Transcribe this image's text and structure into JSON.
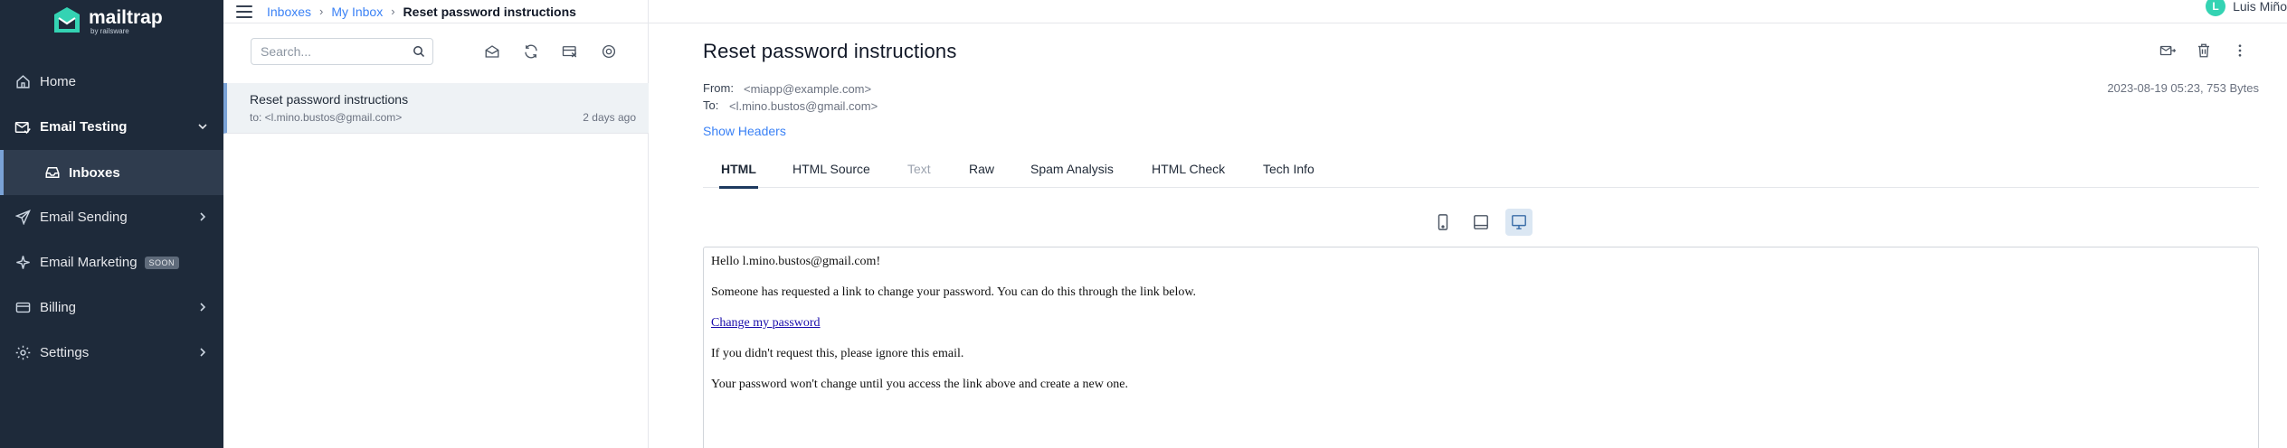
{
  "brand": {
    "name": "mailtrap",
    "sub": "by railsware"
  },
  "sidebar": {
    "items": [
      {
        "label": "Home",
        "icon": "home-icon"
      },
      {
        "label": "Email Testing",
        "icon": "email-testing-icon"
      },
      {
        "label": "Inboxes",
        "icon": "inbox-icon"
      },
      {
        "label": "Email Sending",
        "icon": "send-icon"
      },
      {
        "label": "Email Marketing",
        "icon": "sparkle-icon",
        "badge": "SOON"
      },
      {
        "label": "Billing",
        "icon": "billing-icon"
      },
      {
        "label": "Settings",
        "icon": "gear-icon"
      }
    ]
  },
  "breadcrumb": {
    "items": [
      "Inboxes",
      "My Inbox"
    ],
    "current": "Reset password instructions"
  },
  "user": {
    "initial": "L",
    "name": "Luis Miño"
  },
  "search": {
    "placeholder": "Search..."
  },
  "messages": [
    {
      "subject": "Reset password instructions",
      "to": "to: <l.mino.bustos@gmail.com>",
      "time": "2 days ago"
    }
  ],
  "email": {
    "subject": "Reset password instructions",
    "from_label": "From:",
    "from": "<miapp@example.com>",
    "to_label": "To:",
    "to": "<l.mino.bustos@gmail.com>",
    "show_headers": "Show Headers",
    "meta": "2023-08-19 05:23, 753 Bytes",
    "tabs": [
      "HTML",
      "HTML Source",
      "Text",
      "Raw",
      "Spam Analysis",
      "HTML Check",
      "Tech Info"
    ],
    "active_tab": "HTML",
    "body": {
      "greeting": "Hello l.mino.bustos@gmail.com!",
      "line1": "Someone has requested a link to change your password. You can do this through the link below.",
      "link": "Change my password",
      "line2": "If you didn't request this, please ignore this email.",
      "line3": "Your password won't change until you access the link above and create a new one."
    }
  },
  "colors": {
    "sidebar": "#1e2a3a",
    "accent": "#3b82f6",
    "active_tab": "#1e3a5f",
    "avatar": "#34d3b3"
  }
}
